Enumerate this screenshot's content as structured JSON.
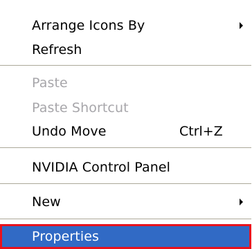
{
  "menu": {
    "arrange_icons_by": "Arrange Icons By",
    "refresh": "Refresh",
    "paste": "Paste",
    "paste_shortcut": "Paste Shortcut",
    "undo_move": "Undo Move",
    "undo_move_shortcut": "Ctrl+Z",
    "nvidia_control_panel": "NVIDIA Control Panel",
    "new": "New",
    "properties": "Properties"
  },
  "colors": {
    "highlight": "#316ac5",
    "highlight_border": "#e8121d",
    "disabled_text": "#a7a6aa",
    "separator": "#aca899"
  }
}
